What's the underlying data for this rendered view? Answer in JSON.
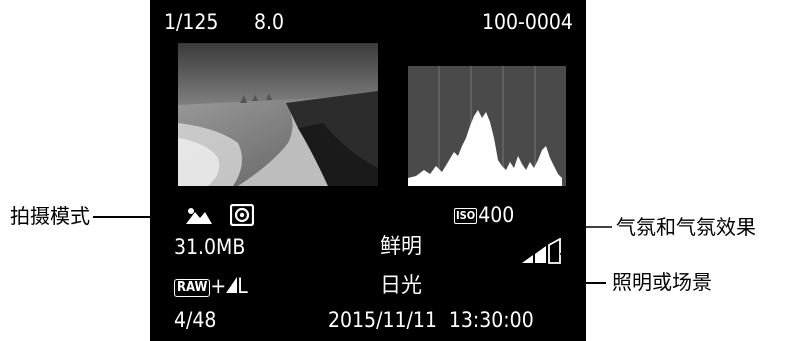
{
  "top": {
    "shutter": "1/125",
    "aperture": "8.0",
    "file_number": "100-0004"
  },
  "middle": {
    "metering_icon": "evaluative-metering-icon",
    "mode_icon": "landscape-mode-icon",
    "iso_badge": "ISO",
    "iso_value": "400"
  },
  "row2": {
    "file_size": "31.0MB",
    "picture_style": "鲜明",
    "ambience_level": 2
  },
  "row3": {
    "raw_badge": "RAW",
    "quality_sep": "+",
    "quality_size": "L",
    "white_balance": "日光"
  },
  "row4": {
    "frame_counter": "4/48",
    "datetime": "2015/11/11  13:30:00"
  },
  "callouts": {
    "shooting_mode": "拍摄模式",
    "ambience": "气氛和气氛效果",
    "lighting": "照明或场景"
  },
  "colors": {
    "screen_bg": "#000000",
    "text": "#ffffff",
    "histogram_bg": "#4a4a4a"
  }
}
